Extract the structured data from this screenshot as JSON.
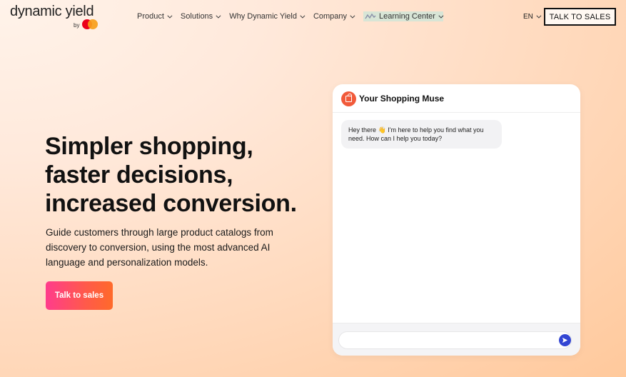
{
  "brand": {
    "logo_text": "dynamic yield",
    "by": "by"
  },
  "nav": {
    "items": [
      {
        "label": "Product"
      },
      {
        "label": "Solutions"
      },
      {
        "label": "Why Dynamic Yield"
      },
      {
        "label": "Company"
      },
      {
        "label": "Learning Center"
      }
    ],
    "lang": "EN",
    "cta": "TALK TO SALES"
  },
  "hero": {
    "headline": [
      "Simpler shopping,",
      "faster decisions,",
      "increased conversion."
    ],
    "subtext": "Guide customers through large product catalogs from discovery to conversion, using the most advanced AI language and personalization models.",
    "cta": "Talk to sales"
  },
  "chat": {
    "title": "Your Shopping Muse",
    "message": "Hey there 👋 I'm here to help you find what you need. How can I help you today?",
    "input_value": "",
    "input_placeholder": ""
  },
  "colors": {
    "cta_gradient_start": "#ff3c8c",
    "cta_gradient_end": "#ff6a2a",
    "send_button": "#3346d3",
    "bot_avatar": "#f15a3a"
  },
  "icons": {
    "avatar": "shopping-bag-icon",
    "send": "send-arrow-icon",
    "learning_center": "wave-icon"
  }
}
